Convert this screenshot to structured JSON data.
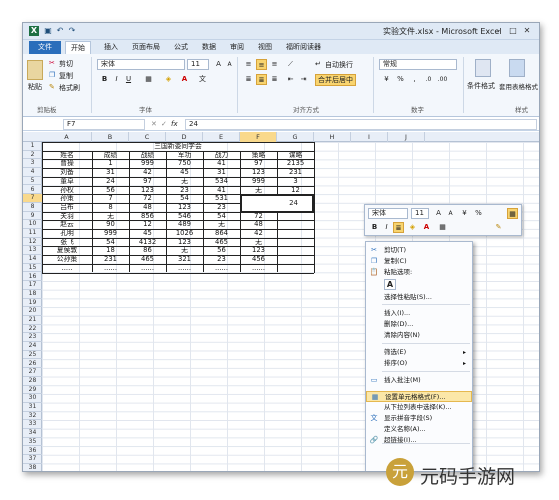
{
  "window": {
    "title": "实验文件.xlsx - Microsoft Excel",
    "min": "–",
    "max": "□",
    "close": "✕"
  },
  "tabs": [
    "文件",
    "开始",
    "插入",
    "页面布局",
    "公式",
    "数据",
    "审阅",
    "视图",
    "福昕阅读器"
  ],
  "ribbon": {
    "cut": "剪切",
    "copy": "复制",
    "format_painter": "格式刷",
    "paste": "粘贴",
    "font": "宋体",
    "size": "11",
    "bold": "B",
    "italic": "I",
    "underline": "U",
    "wrap": "自动换行",
    "merge": "合并后居中",
    "number_format": "常规",
    "cond_format": "条件格式",
    "table_format": "套用表格格式",
    "group_clipboard": "剪贴板",
    "group_font": "字体",
    "group_align": "对齐方式",
    "group_number": "数字",
    "group_style": "样式"
  },
  "formula": {
    "name_box": "F7",
    "fx": "fx",
    "value": "24"
  },
  "columns": [
    "A",
    "B",
    "C",
    "D",
    "E",
    "F",
    "G",
    "H",
    "I",
    "J"
  ],
  "rows": [
    "1",
    "2",
    "3",
    "4",
    "5",
    "6",
    "7",
    "8",
    "9",
    "10",
    "11",
    "12",
    "13",
    "14",
    "15",
    "16",
    "17",
    "18",
    "19",
    "20",
    "21",
    "22",
    "23",
    "24",
    "25",
    "26",
    "27",
    "28",
    "29",
    "30",
    "31",
    "32",
    "33",
    "34",
    "35",
    "36",
    "37",
    "38"
  ],
  "sheet": {
    "title": "三国新委同学会",
    "headers": [
      "姓名",
      "成绩",
      "战绩",
      "军功",
      "战力",
      "策略",
      "谋略"
    ],
    "data": [
      [
        "曹操",
        "1",
        "999",
        "750",
        "41",
        "97",
        "2135"
      ],
      [
        "刘备",
        "31",
        "42",
        "45",
        "31",
        "123",
        "231"
      ],
      [
        "董卓",
        "24",
        "97",
        "无",
        "534",
        "999",
        "3"
      ],
      [
        "孙权",
        "56",
        "123",
        "23",
        "41",
        "无",
        "12"
      ],
      [
        "孙策",
        "7",
        "72",
        "54",
        "531",
        "",
        ""
      ],
      [
        "吕布",
        "8",
        "48",
        "123",
        "23",
        "",
        ""
      ],
      [
        "关羽",
        "无",
        "856",
        "546",
        "54",
        "72",
        ""
      ],
      [
        "赵云",
        "90",
        "12",
        "489",
        "无",
        "48",
        ""
      ],
      [
        "孔明",
        "999",
        "45",
        "1026",
        "864",
        "42",
        ""
      ],
      [
        "张飞",
        "54",
        "4132",
        "123",
        "465",
        "无",
        ""
      ],
      [
        "夏侯敦",
        "18",
        "86",
        "无",
        "56",
        "123",
        ""
      ],
      [
        "公孙策",
        "231",
        "465",
        "321",
        "23",
        "456",
        ""
      ],
      [
        ".....",
        "......",
        "......",
        "......",
        "......",
        "......",
        ""
      ]
    ],
    "active_value": "24"
  },
  "minitoolbar": {
    "font": "宋体",
    "size": "11",
    "pct": "%",
    "bold": "B",
    "italic": "I"
  },
  "context_menu": [
    {
      "label": "剪切(T)",
      "icon": "cut-icon",
      "glyph": "✂"
    },
    {
      "label": "复制(C)",
      "icon": "copy-icon",
      "glyph": "❐"
    },
    {
      "label": "粘贴选项:",
      "icon": "paste-icon",
      "glyph": "📋"
    },
    {
      "label": "选择性粘贴(S)...",
      "icon": "",
      "glyph": ""
    },
    {
      "label": "插入(I)...",
      "icon": "",
      "glyph": ""
    },
    {
      "label": "删除(D)...",
      "icon": "",
      "glyph": ""
    },
    {
      "label": "清除内容(N)",
      "icon": "",
      "glyph": ""
    },
    {
      "label": "筛选(E)",
      "icon": "",
      "glyph": ""
    },
    {
      "label": "排序(O)",
      "icon": "",
      "glyph": ""
    },
    {
      "label": "插入批注(M)",
      "icon": "comment-icon",
      "glyph": "▭"
    },
    {
      "label": "设置单元格格式(F)...",
      "icon": "format-cells-icon",
      "glyph": "▦"
    },
    {
      "label": "从下拉列表中选择(K)...",
      "icon": "",
      "glyph": ""
    },
    {
      "label": "显示拼音字段(S)",
      "icon": "pinyin-icon",
      "glyph": "文"
    },
    {
      "label": "定义名称(A)...",
      "icon": "",
      "glyph": ""
    },
    {
      "label": "超链接(I)...",
      "icon": "hyperlink-icon",
      "glyph": "🔗"
    }
  ],
  "paste_option": "A",
  "watermark": "元码手游网",
  "watermark_logo": "元"
}
